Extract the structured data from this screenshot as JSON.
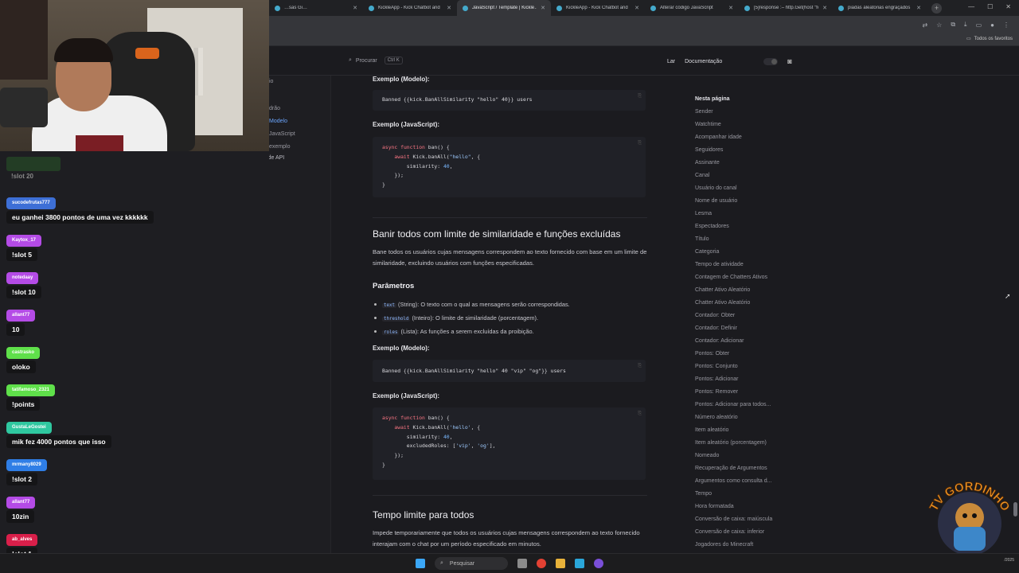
{
  "browser": {
    "tabs": [
      {
        "title": "…sas Gi…",
        "active": false
      },
      {
        "title": "KickleApp - Kick Chatbot and",
        "active": false
      },
      {
        "title": "JavaScript / Template | Kickle…",
        "active": true
      },
      {
        "title": "KickleApp - Kick Chatbot and",
        "active": false
      },
      {
        "title": "Alterar código JavaScript",
        "active": false
      },
      {
        "title": "[5]response :– http.Get(host \"fo",
        "active": false
      },
      {
        "title": "piadas aleatorias engraçados",
        "active": false
      }
    ],
    "new_tab": "+",
    "bookmarks_all": "Todos os favoritos"
  },
  "topnav": {
    "search_label": "Procurar",
    "search_shortcut": "Ctrl K",
    "link_home": "Lar",
    "link_docs": "Documentação"
  },
  "sidebar_fragments": [
    {
      "text": "io",
      "active": false
    },
    {
      "text": "drão",
      "active": false
    },
    {
      "text": "Modelo",
      "active": true
    },
    {
      "text": "JavaScript",
      "active": false
    },
    {
      "text": "exemplo",
      "active": false
    }
  ],
  "sidebar_token_link": "Uso do Token de API",
  "content": {
    "ex1_model_title": "Exemplo (Modelo):",
    "ex1_model_code": "Banned {{kick.BanAllSimilarity \"hello\" 40}} users",
    "ex1_js_title": "Exemplo (JavaScript):",
    "ex1_js_code": [
      "async function ban() {",
      "    await Kick.banAll(\"hello\", {",
      "        similarity: 40,",
      "    });",
      "}"
    ],
    "section2_title": "Banir todos com limite de similaridade e funções excluídas",
    "section2_desc": "Bane todos os usuários cujas mensagens correspondem ao texto fornecido com base em um limite de similaridade, excluindo usuários com funções especificadas.",
    "params_title": "Parâmetros",
    "params": [
      {
        "code": "text",
        "desc": " (String): O texto com o qual as mensagens serão correspondidas."
      },
      {
        "code": "threshold",
        "desc": " (Inteiro): O limite de similaridade (porcentagem)."
      },
      {
        "code": "roles",
        "desc": " (Lista): As funções a serem excluídas da proibição."
      }
    ],
    "ex2_model_title": "Exemplo (Modelo):",
    "ex2_model_code": "Banned {{kick.BanAllSimilarity \"hello\" 40 \"vip\" \"og\"}} users",
    "ex2_js_title": "Exemplo (JavaScript):",
    "ex2_js_code": [
      "async function ban() {",
      "    await Kick.banAll('hello', {",
      "        similarity: 40,",
      "        excludedRoles: ['vip', 'og'],",
      "    });",
      "}"
    ],
    "section3_title": "Tempo limite para todos",
    "section3_desc": "Impede temporariamente que todos os usuários cujas mensagens correspondem ao texto fornecido interajam com o chat por um período especificado em minutos."
  },
  "toc": {
    "heading": "Nesta página",
    "items": [
      "Sender",
      "Watchtime",
      "Acompanhar idade",
      "Seguidores",
      "Assinante",
      "Canal",
      "Usuário do canal",
      "Nome de usuário",
      "Lesma",
      "Espectadores",
      "Título",
      "Categoria",
      "Tempo de atividade",
      "Contagem de Chatters Ativos",
      "Chatter Ativo Aleatório",
      "Chatter Ativo Aleatório",
      "Contador: Obter",
      "Contador: Definir",
      "Contador: Adicionar",
      "Pontos: Obter",
      "Pontos: Conjunto",
      "Pontos: Adicionar",
      "Pontos: Remover",
      "Pontos: Adicionar para todos...",
      "Número aleatório",
      "Item aleatório",
      "Item aleatório (porcentagem)",
      "Nomeado",
      "Recuperação de Argumentos",
      "Argumentos como consulta d...",
      "Tempo",
      "Hora formatada",
      "Conversão de caixa: maiúscula",
      "Conversão de caixa: inferior",
      "Jogadores do Minecraft"
    ]
  },
  "chat": {
    "partial_top": "!slot 20",
    "messages": [
      {
        "user": "sucodefrutas777",
        "color": "#3d6fd6",
        "text": "eu ganhei 3800 pontos de uma vez kkkkkk"
      },
      {
        "user": "Kaytox_17",
        "color": "#b44be6",
        "text": "!slot 5"
      },
      {
        "user": "notedaay",
        "color": "#b44be6",
        "text": "!slot 10"
      },
      {
        "user": "allant77",
        "color": "#b44be6",
        "text": "10"
      },
      {
        "user": "castrasko",
        "color": "#5fe04a",
        "text": "oloko"
      },
      {
        "user": "tatifamoso_2321",
        "color": "#5fe04a",
        "text": "!points"
      },
      {
        "user": "GustaLeGostei",
        "color": "#2fc8a0",
        "text": "mik fez 4000 pontos que isso"
      },
      {
        "user": "mrmany8029",
        "color": "#2f7ee6",
        "text": "!slot 2"
      },
      {
        "user": "allant77",
        "color": "#b44be6",
        "text": "10zin"
      },
      {
        "user": "ab_alves",
        "color": "#d91f4a",
        "text": "!slot 1"
      }
    ]
  },
  "watermark": {
    "text": "TV GORDINHO"
  },
  "taskbar": {
    "search_label": "Pesquisar",
    "date_fragment": "/2025"
  },
  "colors": {
    "accent": "#6ba6ff",
    "bg": "#1b1b1f"
  }
}
